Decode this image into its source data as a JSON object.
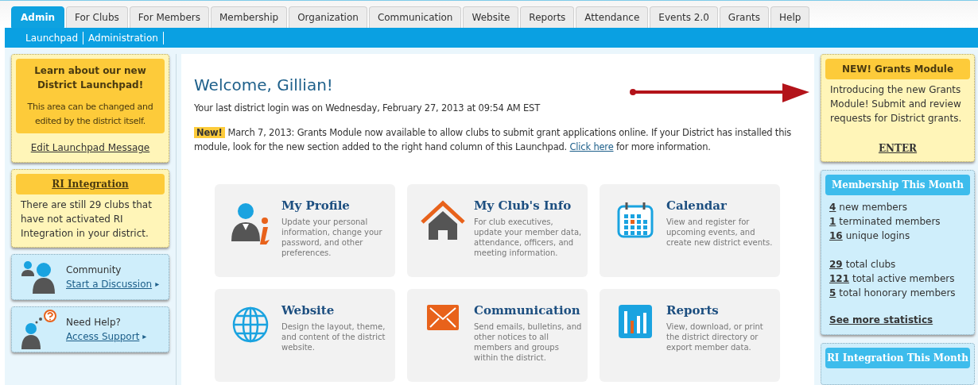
{
  "tabs": [
    {
      "label": "Admin",
      "selected": true
    },
    {
      "label": "For Clubs",
      "selected": false
    },
    {
      "label": "For Members",
      "selected": false
    },
    {
      "label": "Membership",
      "selected": false
    },
    {
      "label": "Organization",
      "selected": false
    },
    {
      "label": "Communication",
      "selected": false
    },
    {
      "label": "Website",
      "selected": false
    },
    {
      "label": "Reports",
      "selected": false
    },
    {
      "label": "Attendance",
      "selected": false
    },
    {
      "label": "Events 2.0",
      "selected": false
    },
    {
      "label": "Grants",
      "selected": false
    },
    {
      "label": "Help",
      "selected": false
    }
  ],
  "subnav": [
    "Launchpad",
    "Administration"
  ],
  "left": {
    "launchpad_box": {
      "title": "Learn about our new District Launchpad!",
      "body": "This area can be changed and edited by the district itself.",
      "link": "Edit Launchpad Message"
    },
    "ri_box": {
      "title": "RI Integration",
      "body": "There are still 29 clubs that have not activated RI Integration in your district."
    },
    "help_cards": [
      {
        "kind": "community",
        "label": "Community",
        "link": "Start a Discussion",
        "arrow": "▸"
      },
      {
        "kind": "help",
        "label": "Need Help?",
        "link": "Access Support",
        "arrow": "▸"
      }
    ]
  },
  "main": {
    "heading": "Welcome, Gillian!",
    "last_login": "Your last district login was on Wednesday, February 27, 2013 at 09:54 AM EST",
    "news_badge": "New!",
    "news_text": "March 7, 2013: Grants Module now available to allow clubs to submit grant applications online. If your District has installed this module, look for the new section added to the right hand column of this Launchpad.",
    "news_link": "Click here",
    "news_tail": "for more information.",
    "tiles": [
      {
        "kind": "profile",
        "title": "My Profile",
        "text": "Update your personal information, change your password, and other preferences."
      },
      {
        "kind": "club",
        "title": "My Club's Info",
        "text": "For club executives, update your member data, attendance, officers, and meeting information."
      },
      {
        "kind": "calendar",
        "title": "Calendar",
        "text": "View and register for upcoming events, and create new district events."
      },
      {
        "kind": "website",
        "title": "Website",
        "text": "Design the layout, theme, and content of the district website."
      },
      {
        "kind": "communication",
        "title": "Communication",
        "text": "Send emails, bulletins, and other notices to all members and groups within the district."
      },
      {
        "kind": "reports",
        "title": "Reports",
        "text": "View, download, or print the district directory or export member data."
      }
    ]
  },
  "right": {
    "grants_box": {
      "title": "NEW! Grants Module",
      "body": "Introducing the new Grants Module! Submit and review requests for District grants.",
      "link": "ENTER"
    },
    "membership_box": {
      "title": "Membership This Month",
      "groups": [
        [
          {
            "count": "4",
            "label": "new members"
          },
          {
            "count": "1",
            "label": "terminated members"
          },
          {
            "count": "16",
            "label": "unique logins"
          }
        ],
        [
          {
            "count": "29",
            "label": "total clubs"
          },
          {
            "count": "121",
            "label": "total active members"
          },
          {
            "count": "5",
            "label": "total honorary members"
          }
        ]
      ],
      "link": "See more statistics"
    },
    "ri_month_box": {
      "title": "RI Integration This Month"
    }
  }
}
